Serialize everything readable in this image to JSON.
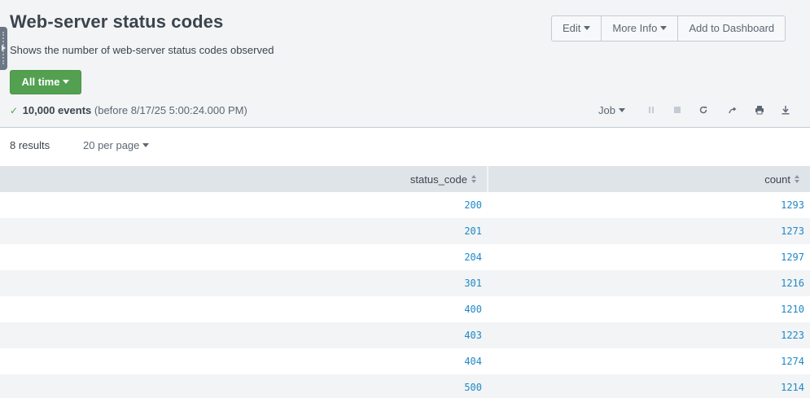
{
  "header": {
    "title": "Web-server status codes",
    "description": "Shows the number of web-server status codes observed",
    "actions": {
      "edit": "Edit",
      "more_info": "More Info",
      "add_to_dashboard": "Add to Dashboard"
    },
    "time_range": "All time",
    "status": {
      "event_count": "10,000 events",
      "before": "(before 8/17/25 5:00:24.000 PM)"
    },
    "job_label": "Job",
    "colors": {
      "accent_green": "#53a051",
      "link_blue": "#1e88c7"
    }
  },
  "results": {
    "count_label": "8 results",
    "per_page": "20 per page",
    "columns": [
      "status_code",
      "count"
    ],
    "rows": [
      [
        "200",
        "1293"
      ],
      [
        "201",
        "1273"
      ],
      [
        "204",
        "1297"
      ],
      [
        "301",
        "1216"
      ],
      [
        "400",
        "1210"
      ],
      [
        "403",
        "1223"
      ],
      [
        "404",
        "1274"
      ],
      [
        "500",
        "1214"
      ]
    ]
  }
}
